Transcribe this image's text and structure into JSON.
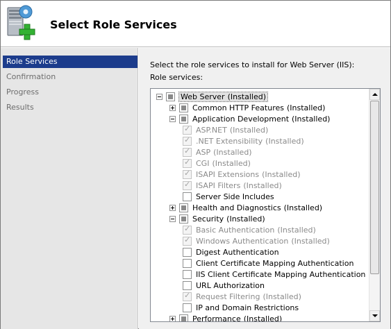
{
  "header": {
    "title": "Select Role Services",
    "icon": "server-add-icon"
  },
  "sidebar": {
    "items": [
      {
        "label": "Role Services",
        "selected": true
      },
      {
        "label": "Confirmation",
        "selected": false
      },
      {
        "label": "Progress",
        "selected": false
      },
      {
        "label": "Results",
        "selected": false
      }
    ]
  },
  "main": {
    "instruction": "Select the role services to install for Web Server (IIS):",
    "role_services_label": "Role services:"
  },
  "tree": [
    {
      "label": "Web Server",
      "status": "(Installed)",
      "expander": "minus",
      "check": "partial",
      "disabled": false
    },
    {
      "label": "Common HTTP Features",
      "status": "(Installed)",
      "expander": "plus",
      "check": "partial",
      "disabled": false
    },
    {
      "label": "Application Development",
      "status": "(Installed)",
      "expander": "minus",
      "check": "partial",
      "disabled": false
    },
    {
      "label": "ASP.NET",
      "status": "(Installed)",
      "expander": "none",
      "check": "checked",
      "disabled": true
    },
    {
      "label": ".NET Extensibility",
      "status": "(Installed)",
      "expander": "none",
      "check": "checked",
      "disabled": true
    },
    {
      "label": "ASP",
      "status": "(Installed)",
      "expander": "none",
      "check": "checked",
      "disabled": true
    },
    {
      "label": "CGI",
      "status": "(Installed)",
      "expander": "none",
      "check": "checked",
      "disabled": true
    },
    {
      "label": "ISAPI Extensions",
      "status": "(Installed)",
      "expander": "none",
      "check": "checked",
      "disabled": true
    },
    {
      "label": "ISAPI Filters",
      "status": "(Installed)",
      "expander": "none",
      "check": "checked",
      "disabled": true
    },
    {
      "label": "Server Side Includes",
      "status": "",
      "expander": "none",
      "check": "unchecked",
      "disabled": false
    },
    {
      "label": "Health and Diagnostics",
      "status": "(Installed)",
      "expander": "plus",
      "check": "partial",
      "disabled": false
    },
    {
      "label": "Security",
      "status": "(Installed)",
      "expander": "minus",
      "check": "partial",
      "disabled": false
    },
    {
      "label": "Basic Authentication",
      "status": "(Installed)",
      "expander": "none",
      "check": "checked",
      "disabled": true
    },
    {
      "label": "Windows Authentication",
      "status": "(Installed)",
      "expander": "none",
      "check": "checked",
      "disabled": true
    },
    {
      "label": "Digest Authentication",
      "status": "",
      "expander": "none",
      "check": "unchecked",
      "disabled": false
    },
    {
      "label": "Client Certificate Mapping Authentication",
      "status": "",
      "expander": "none",
      "check": "unchecked",
      "disabled": false
    },
    {
      "label": "IIS Client Certificate Mapping Authentication",
      "status": "",
      "expander": "none",
      "check": "unchecked",
      "disabled": false
    },
    {
      "label": "URL Authorization",
      "status": "",
      "expander": "none",
      "check": "unchecked",
      "disabled": false
    },
    {
      "label": "Request Filtering",
      "status": "(Installed)",
      "expander": "none",
      "check": "checked",
      "disabled": true
    },
    {
      "label": "IP and Domain Restrictions",
      "status": "",
      "expander": "none",
      "check": "unchecked",
      "disabled": false
    },
    {
      "label": "Performance",
      "status": "(Installed)",
      "expander": "plus",
      "check": "partial",
      "disabled": false
    }
  ],
  "colors": {
    "nav_selected_bg": "#1c3c8c",
    "sidebar_bg": "#e6e6e6",
    "main_bg": "#f0f0f0"
  }
}
